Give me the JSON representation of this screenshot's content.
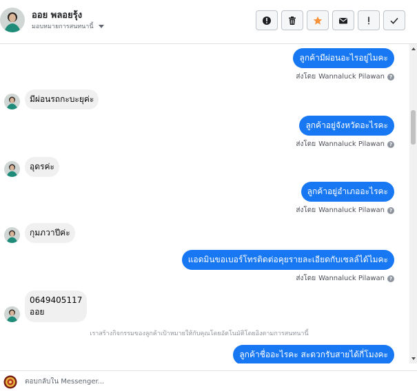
{
  "header": {
    "contact_name": "ออย พลอยรุ้ง",
    "assign_label": "มอบหมายการสนทนานี้",
    "toolbar": {
      "info_label": "!",
      "follow_up_label": "!"
    }
  },
  "thread": {
    "messages": [
      {
        "direction": "out",
        "text": "ลูกค้ามีผ่อนอะไรอยู่ไมคะ",
        "sent_by_prefix": "ส่งโดย",
        "sent_by_name": "Wannaluck Pilawan"
      },
      {
        "direction": "in",
        "text": "มีผ่อนรถกะบะยุค่ะ"
      },
      {
        "direction": "out",
        "text": "ลูกค้าอยู่จังหวัดอะไรคะ",
        "sent_by_prefix": "ส่งโดย",
        "sent_by_name": "Wannaluck Pilawan"
      },
      {
        "direction": "in",
        "text": "อุดรค่ะ"
      },
      {
        "direction": "out",
        "text": "ลูกค้าอยู่อำเภออะไรคะ",
        "sent_by_prefix": "ส่งโดย",
        "sent_by_name": "Wannaluck Pilawan"
      },
      {
        "direction": "in",
        "text": "กุมภวาปีค่ะ"
      },
      {
        "direction": "out",
        "text": "แอดมินขอเบอร์โทรติดต่อคุยรายละเอียดกับเซลล์ได้ไมคะ",
        "sent_by_prefix": "ส่งโดย",
        "sent_by_name": "Wannaluck Pilawan"
      },
      {
        "direction": "in",
        "line1": "0649405117",
        "line2": "ออย"
      },
      {
        "direction": "out",
        "text": "ลูกค้าชื่ออะไรคะ สะดวกรับสายได้กี่โมงคะ"
      }
    ],
    "system_note": "เราสร้างกิจกรรมของลูกค้าเป้าหมายให้กับคุณโดยอัตโนมัติโดยอิงตามการสนทนานี้"
  },
  "composer": {
    "placeholder": "ตอบกลับใน Messenger..."
  },
  "colors": {
    "outgoing_bubble": "#1877f2",
    "incoming_bubble": "#f1f0f0",
    "star_active": "#f7923b"
  },
  "icons": [
    "alert-circle-icon",
    "trash-icon",
    "star-icon",
    "envelope-icon",
    "exclamation-icon",
    "check-icon",
    "chevron-down-icon",
    "help-circle-icon"
  ]
}
